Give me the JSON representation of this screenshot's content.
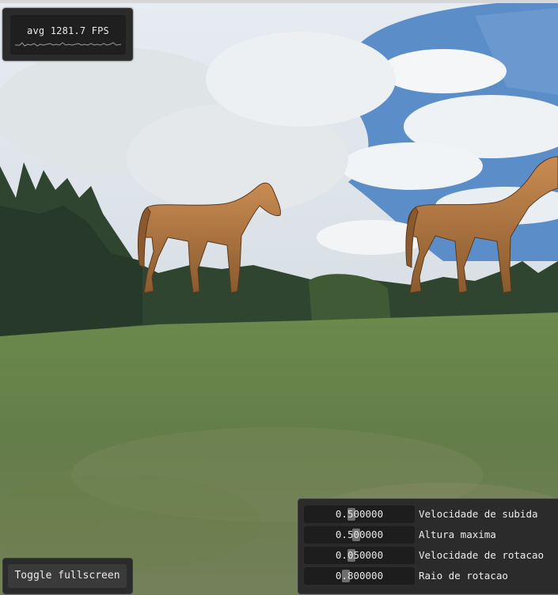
{
  "fps": {
    "text": "avg 1281.7 FPS"
  },
  "fullscreen": {
    "label": "Toggle fullscreen"
  },
  "params": [
    {
      "value": "0.500000",
      "label": "Velocidade de subida",
      "fraction": 0.42
    },
    {
      "value": "0.500000",
      "label": "Altura maxima",
      "fraction": 0.47
    },
    {
      "value": "0.050000",
      "label": "Velocidade de rotacao",
      "fraction": 0.42
    },
    {
      "value": "0.800000",
      "label": "Raio de rotacao",
      "fraction": 0.37
    }
  ],
  "colors": {
    "panel": "#2b2b2b",
    "sky": "#b9cde4",
    "grass": "#6f8652",
    "horse": "#b97c45"
  }
}
